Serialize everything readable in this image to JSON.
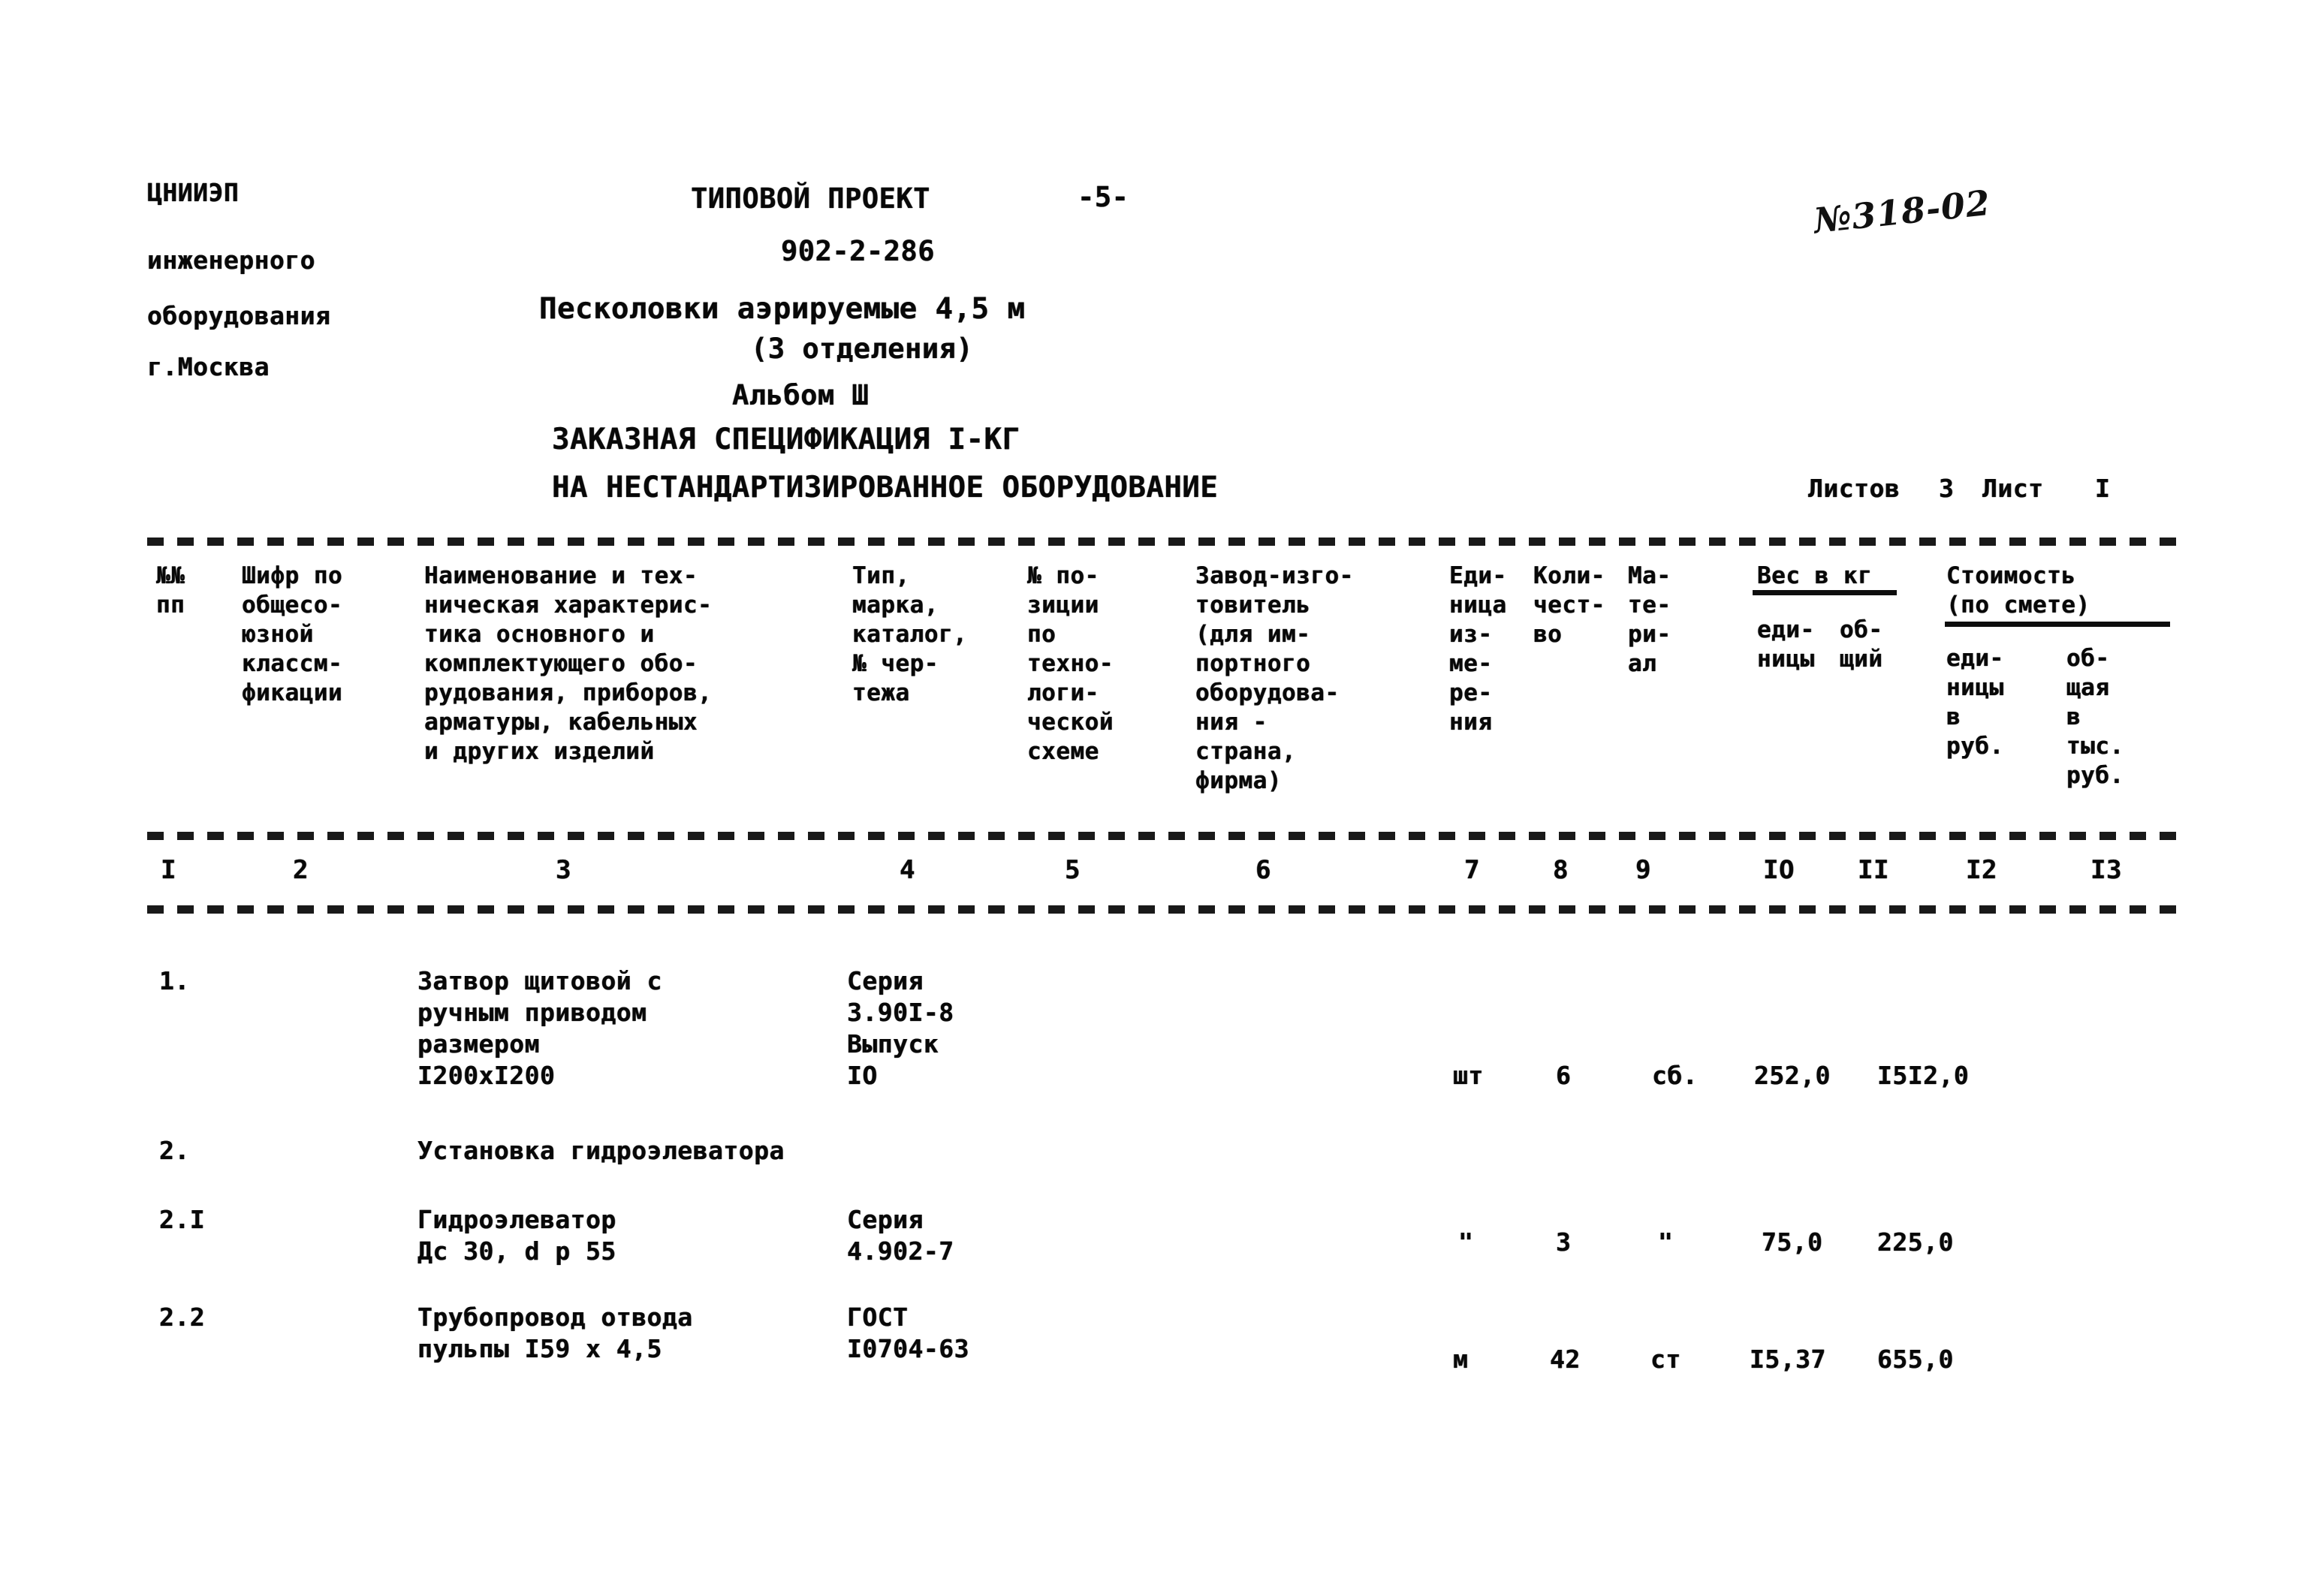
{
  "organization": {
    "line1": "ЦНИИЭП",
    "line2": "инженерного",
    "line3": "оборудования",
    "line4": "г.Москва"
  },
  "header": {
    "project_label": "ТИПОВОЙ ПРОЕКТ",
    "page_marker": "-5-",
    "project_number": "902-2-286",
    "object_title": "Песколовки аэрируемые 4,5 м",
    "object_subtitle": "(3 отделения)",
    "album": "Альбом Ш",
    "spec_title": "ЗАКАЗНАЯ СПЕЦИФИКАЦИЯ I-КГ",
    "spec_subtitle": "НА НЕСТАНДАРТИЗИРОВАННОЕ ОБОРУДОВАНИЕ",
    "sheets_label": "Листов",
    "sheets_count": "3",
    "sheet_label": "Лист",
    "sheet_number": "I",
    "handwritten_mark": "№318-02"
  },
  "table": {
    "columns": [
      {
        "number": "I",
        "title": "№№\nпп"
      },
      {
        "number": "2",
        "title": "Шифр по\nобщесо-\nюзной\nклассм-\nфикации"
      },
      {
        "number": "3",
        "title": "Наименование и тех-\nническая характерис-\nтика основного и\nкомплектующего обо-\nрудования, приборов,\nарматуры, кабельных\nи других изделий"
      },
      {
        "number": "4",
        "title": "Тип,\nмарка,\nкаталог,\n№ чер-\nтежа"
      },
      {
        "number": "5",
        "title": "№ по-\nзиции\nпо\nтехно-\nлоги-\nческой\nсхеме"
      },
      {
        "number": "6",
        "title": "Завод-изго-\nтовитель\n(для им-\nпортного\nоборудова-\nния -\nстрана,\nфирма)"
      },
      {
        "number": "7",
        "title": "Еди-\nница\nиз-\nме-\nре-\nния"
      },
      {
        "number": "8",
        "title": "Коли-\nчест-\nво"
      },
      {
        "number": "9",
        "title": "Ма-\nте-\nри-\nал"
      },
      {
        "number": "IO",
        "title": "еди-\nницы"
      },
      {
        "number": "II",
        "title": "об-\nщий"
      },
      {
        "number": "I2",
        "title": "еди-\nницы\nв\nруб."
      },
      {
        "number": "I3",
        "title": "об-\nщая\nв\nтыс.\nруб."
      }
    ],
    "group_headers": [
      {
        "label": "Вес в кг",
        "spans": [
          "IO",
          "II"
        ]
      },
      {
        "label": "Стоимость\n(по смете)",
        "spans": [
          "I2",
          "I3"
        ]
      }
    ],
    "rows": [
      {
        "no": "1.",
        "code": "",
        "name": "Затвор щитовой с\nручным приводом\nразмером\nI200xI200",
        "type": "Серия\n3.90I-8\nВыпуск\nIO",
        "position": "",
        "manufacturer": "",
        "unit": "шт",
        "qty": "6",
        "material": "сб.",
        "weight_unit": "252,0",
        "weight_total": "I5I2,0",
        "cost_unit": "",
        "cost_total": ""
      },
      {
        "no": "2.",
        "code": "",
        "name": "Установка гидроэлеватора",
        "type": "",
        "position": "",
        "manufacturer": "",
        "unit": "",
        "qty": "",
        "material": "",
        "weight_unit": "",
        "weight_total": "",
        "cost_unit": "",
        "cost_total": ""
      },
      {
        "no": "2.I",
        "code": "",
        "name": "Гидроэлеватор\nДс 30, d р 55",
        "type": "Серия\n4.902-7",
        "position": "",
        "manufacturer": "",
        "unit": "\"",
        "qty": "3",
        "material": "\"",
        "weight_unit": "75,0",
        "weight_total": "225,0",
        "cost_unit": "",
        "cost_total": ""
      },
      {
        "no": "2.2",
        "code": "",
        "name": "Трубопровод отвода\nпульпы I59 х 4,5",
        "type": "ГОСТ\nI0704-63",
        "position": "",
        "manufacturer": "",
        "unit": "м",
        "qty": "42",
        "material": "ст",
        "weight_unit": "I5,37",
        "weight_total": "655,0",
        "cost_unit": "",
        "cost_total": ""
      }
    ]
  }
}
